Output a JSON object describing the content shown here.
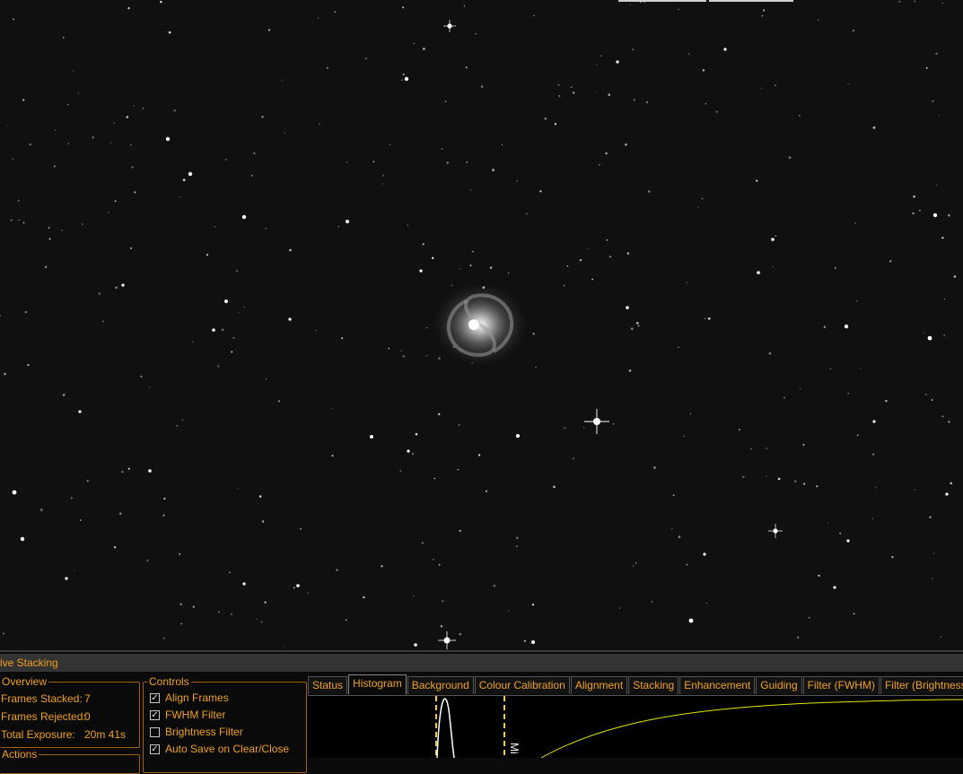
{
  "image_view": {
    "background_color": "#101010",
    "galaxy_color": "#d8d8d8",
    "star_color": "#ffffff"
  },
  "panel": {
    "title": "ive Stacking",
    "overview": {
      "title": "Overview",
      "frames_stacked_label": "Frames Stacked:",
      "frames_stacked_value": "7",
      "frames_rejected_label": "Frames Rejected:",
      "frames_rejected_value": "0",
      "total_exposure_label": "Total Exposure:",
      "total_exposure_value": "20m 41s"
    },
    "actions": {
      "title": "Actions"
    },
    "controls": {
      "title": "Controls",
      "items": [
        {
          "label": "Align Frames",
          "checked": true
        },
        {
          "label": "FWHM Filter",
          "checked": true
        },
        {
          "label": "Brightness Filter",
          "checked": false
        },
        {
          "label": "Auto Save on Clear/Close",
          "checked": true
        }
      ]
    },
    "tabs": [
      {
        "label": "Status",
        "active": false
      },
      {
        "label": "Histogram",
        "active": true
      },
      {
        "label": "Background",
        "active": false
      },
      {
        "label": "Colour Calibration",
        "active": false
      },
      {
        "label": "Alignment",
        "active": false
      },
      {
        "label": "Stacking",
        "active": false
      },
      {
        "label": "Enhancement",
        "active": false
      },
      {
        "label": "Guiding",
        "active": false
      },
      {
        "label": "Filter (FWHM)",
        "active": false
      },
      {
        "label": "Filter (Brightness",
        "active": false
      }
    ],
    "histogram": {
      "marker_label": "Mi",
      "accent_color": "#f0a020",
      "curve_color": "#e6e600"
    }
  }
}
